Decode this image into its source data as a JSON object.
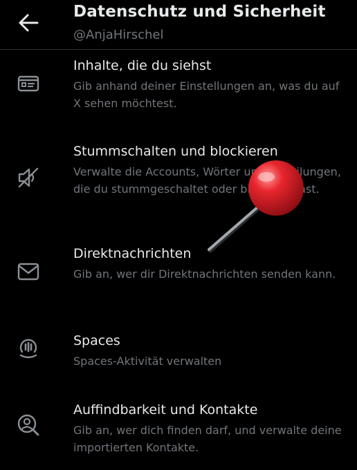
{
  "header": {
    "title": "Datenschutz und Sicherheit",
    "handle": "@AnjaHirschel"
  },
  "items": [
    {
      "icon": "content-preferences-icon",
      "title": "Inhalte, die du siehst",
      "desc": "Gib anhand deiner Einstellungen an, was du auf X sehen möchtest."
    },
    {
      "icon": "muted-speaker-icon",
      "title": "Stummschalten und blockieren",
      "desc": "Verwalte die Accounts, Wörter und Mitteilungen, die du stummgeschaltet oder blockiert hast."
    },
    {
      "icon": "envelope-icon",
      "title": "Direktnachrichten",
      "desc": "Gib an, wer dir Direktnachrichten senden kann."
    },
    {
      "icon": "spaces-icon",
      "title": "Spaces",
      "desc": "Spaces-Aktivität verwalten"
    },
    {
      "icon": "discoverability-icon",
      "title": "Auffindbarkeit und Kontakte",
      "desc": "Gib an, wer dich finden darf, und verwalte deine importierten Kontakte."
    }
  ],
  "colors": {
    "background": "#000000",
    "primary_text": "#e7e9ea",
    "secondary_text": "#71767b",
    "divider": "#2f3336",
    "pin_head": "#d9222a"
  }
}
